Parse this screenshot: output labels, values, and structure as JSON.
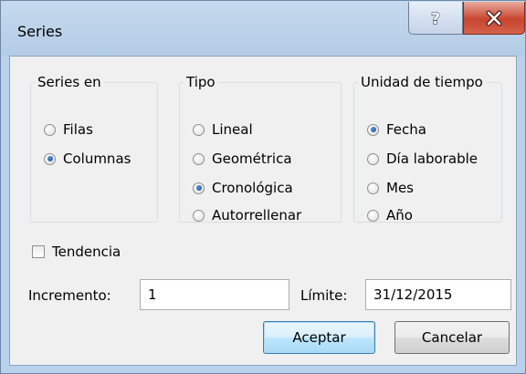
{
  "window": {
    "title": "Series",
    "help_icon": "help-icon",
    "close_icon": "close-icon"
  },
  "series_en": {
    "label": "Series en",
    "options": [
      {
        "label": "Filas",
        "selected": false
      },
      {
        "label": "Columnas",
        "selected": true
      }
    ]
  },
  "tipo": {
    "label": "Tipo",
    "options": [
      {
        "label": "Lineal",
        "selected": false
      },
      {
        "label": "Geométrica",
        "selected": false
      },
      {
        "label": "Cronológica",
        "selected": true
      },
      {
        "label": "Autorrellenar",
        "selected": false
      }
    ]
  },
  "unidad": {
    "label": "Unidad de tiempo",
    "options": [
      {
        "label": "Fecha",
        "selected": true
      },
      {
        "label": "Día laborable",
        "selected": false
      },
      {
        "label": "Mes",
        "selected": false
      },
      {
        "label": "Año",
        "selected": false
      }
    ]
  },
  "tendencia": {
    "label": "Tendencia",
    "checked": false
  },
  "incremento": {
    "label": "Incremento:",
    "value": "1"
  },
  "limite": {
    "label": "Límite:",
    "value": "31/12/2015"
  },
  "buttons": {
    "accept": "Aceptar",
    "cancel": "Cancelar"
  },
  "colors": {
    "frame": "#b9d1ea",
    "client": "#f0f0f0",
    "close_button": "#c8452f",
    "default_button_border": "#3c7fb1",
    "radio_dot": "#1c4c97"
  }
}
